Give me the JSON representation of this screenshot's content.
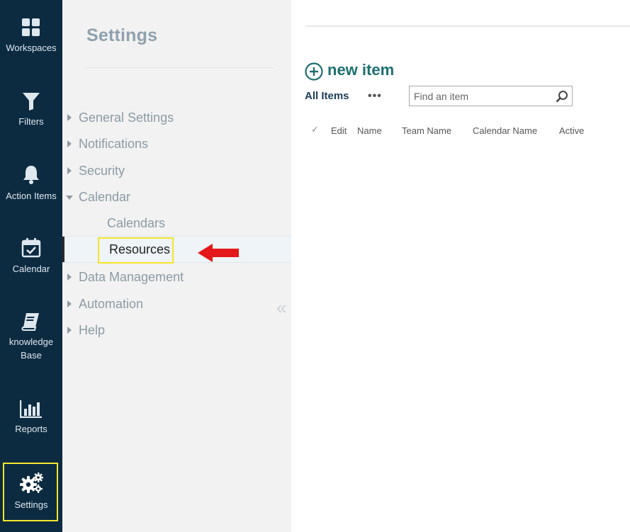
{
  "rail": {
    "items": [
      {
        "label": "Workspaces",
        "icon": "grid-icon"
      },
      {
        "label": "Filters",
        "icon": "filter-icon"
      },
      {
        "label": "Action Items",
        "icon": "bell-icon"
      },
      {
        "label": "Calendar",
        "icon": "calendar-check-icon"
      },
      {
        "label_line1": "knowledge",
        "label_line2": "Base",
        "icon": "book-icon"
      },
      {
        "label": "Reports",
        "icon": "bar-chart-icon"
      },
      {
        "label": "Settings",
        "icon": "gears-icon"
      }
    ]
  },
  "nav": {
    "title": "Settings",
    "items": [
      {
        "label": "General Settings"
      },
      {
        "label": "Notifications"
      },
      {
        "label": "Security"
      },
      {
        "label": "Calendar"
      },
      {
        "label": "Data Management"
      },
      {
        "label": "Automation"
      },
      {
        "label": "Help"
      }
    ],
    "calendar_sub": [
      {
        "label": "Calendars"
      },
      {
        "label": "Resources"
      }
    ],
    "collapse_glyph": "«"
  },
  "main": {
    "new_item_label": "new item",
    "view_label": "All Items",
    "more_label": "•••",
    "search_placeholder": "Find an item",
    "columns": [
      "Edit",
      "Name",
      "Team Name",
      "Calendar Name",
      "Active"
    ],
    "check_glyph": "✓"
  },
  "colors": {
    "rail_bg": "#0c2b41",
    "nav_bg": "#f2f2f2",
    "accent_teal": "#1f6f71",
    "highlight_yellow": "#f5e52c",
    "arrow_red": "#e4181b"
  }
}
